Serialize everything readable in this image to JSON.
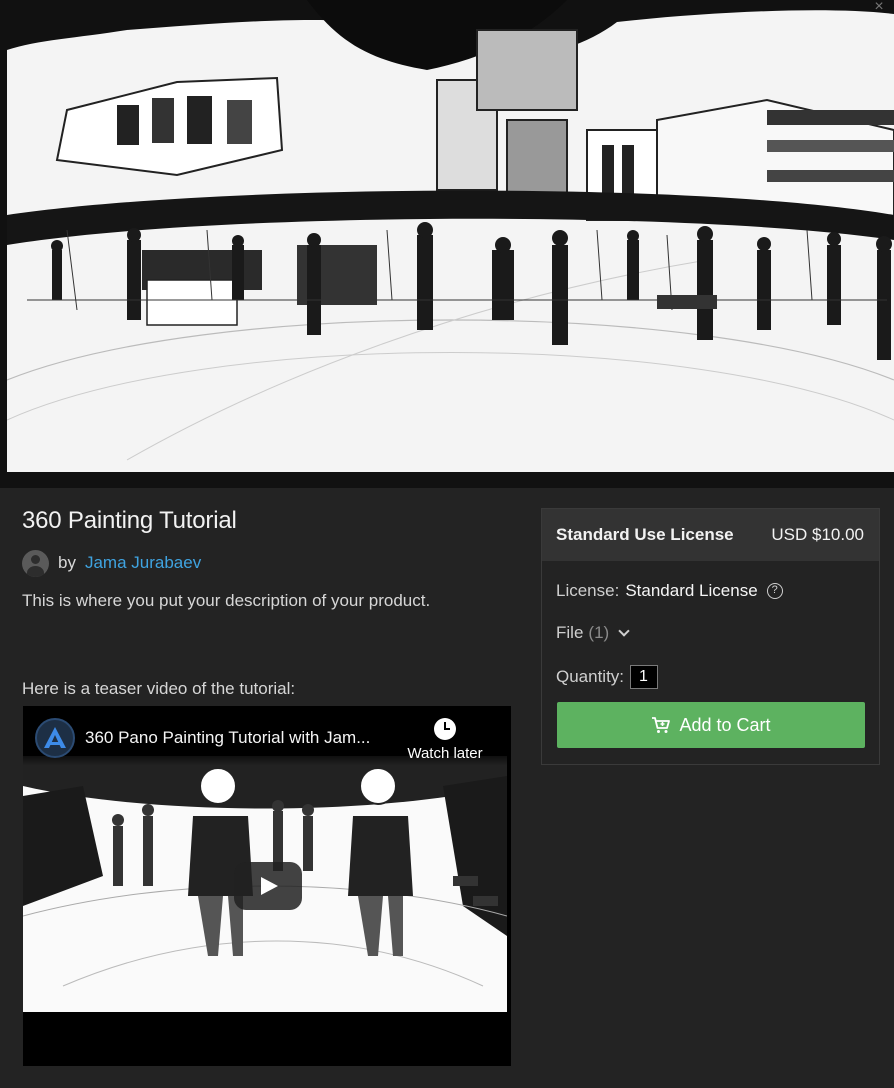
{
  "product": {
    "title": "360 Painting Tutorial",
    "by_label": "by",
    "author": "Jama Jurabaev",
    "description": "This is where you put your description of your product.",
    "teaser_text": "Here is a teaser video of the tutorial:"
  },
  "video": {
    "title": "360 Pano Painting Tutorial with Jam...",
    "watch_later_label": "Watch later"
  },
  "license_box": {
    "license_name": "Standard Use License",
    "price": "USD $10.00",
    "license_label": "License:",
    "license_value": "Standard License",
    "file_label": "File",
    "file_count": "(1)",
    "quantity_label": "Quantity:",
    "quantity_value": "1",
    "add_to_cart_label": "Add to Cart"
  },
  "colors": {
    "background": "#232323",
    "link": "#3fa3e0",
    "add_to_cart": "#5db260",
    "box_header": "#333333"
  },
  "icons": {
    "close": "close-icon",
    "avatar": "user-avatar-icon",
    "help": "question-circle-icon",
    "dropdown": "chevron-down-icon",
    "cart": "cart-plus-icon",
    "clock": "clock-icon",
    "play": "play-icon"
  }
}
